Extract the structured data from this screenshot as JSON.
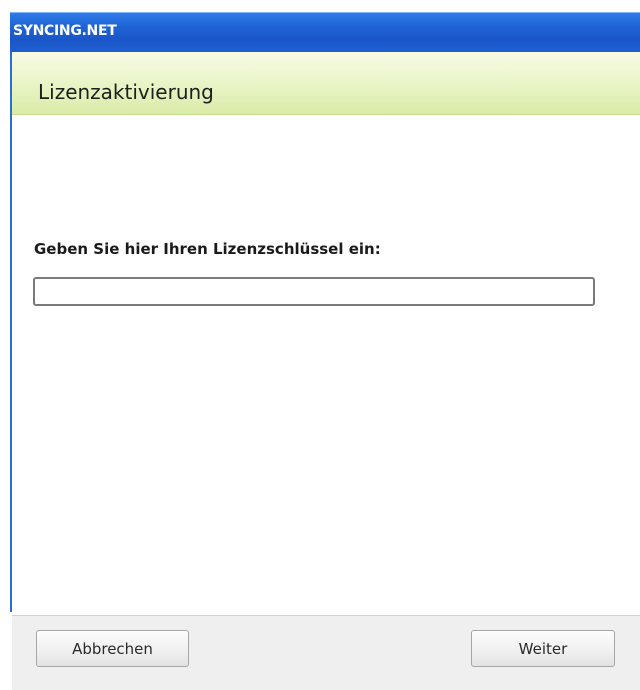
{
  "window": {
    "title": "SYNCING.NET"
  },
  "header": {
    "title": "Lizenzaktivierung"
  },
  "form": {
    "prompt": "Geben Sie hier Ihren Lizenzschlüssel ein:",
    "license_value": "",
    "license_placeholder": ""
  },
  "footer": {
    "cancel_label": "Abbrechen",
    "next_label": "Weiter"
  },
  "colors": {
    "titlebar": "#1f63d6",
    "header_band": "#e8f4c4",
    "footer": "#efefef"
  }
}
